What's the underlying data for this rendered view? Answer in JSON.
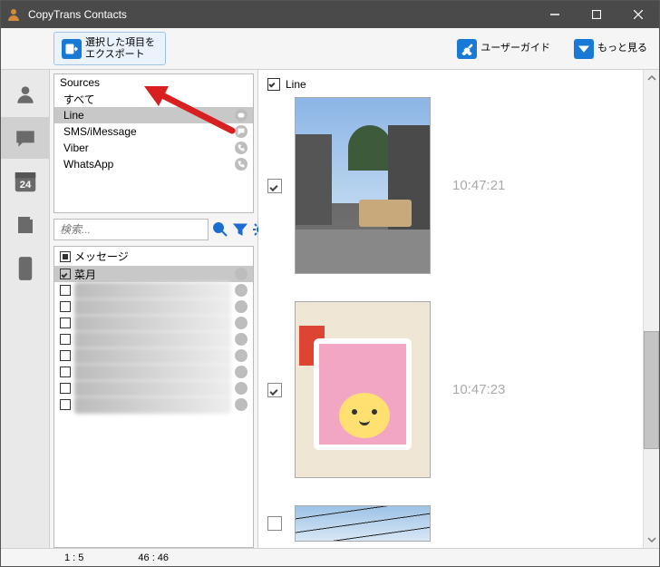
{
  "app": {
    "title": "CopyTrans Contacts"
  },
  "window_controls": {
    "min": "min",
    "max": "max",
    "close": "close"
  },
  "toolbar": {
    "export_label_line1": "選択した項目を",
    "export_label_line2": "エクスポート",
    "user_guide": "ユーザーガイド",
    "more": "もっと見る"
  },
  "nav": [
    {
      "id": "contacts",
      "name": "nav-contacts"
    },
    {
      "id": "messages",
      "name": "nav-messages",
      "active": true
    },
    {
      "id": "calendar",
      "name": "nav-calendar",
      "badge": "24"
    },
    {
      "id": "notes",
      "name": "nav-notes"
    },
    {
      "id": "device",
      "name": "nav-device"
    }
  ],
  "sources": {
    "heading": "Sources",
    "items": [
      {
        "label": "すべて",
        "icon": false,
        "selected": false
      },
      {
        "label": "Line",
        "icon": true,
        "selected": true
      },
      {
        "label": "SMS/iMessage",
        "icon": true,
        "selected": false
      },
      {
        "label": "Viber",
        "icon": true,
        "selected": false
      },
      {
        "label": "WhatsApp",
        "icon": true,
        "selected": false
      }
    ]
  },
  "search": {
    "placeholder": "検索..."
  },
  "messages_panel": {
    "heading": "メッセージ",
    "items": [
      {
        "label": "菜月",
        "checked": true,
        "selected": true,
        "blurred": false
      },
      {
        "label": "",
        "checked": false,
        "selected": false,
        "blurred": true
      },
      {
        "label": "",
        "checked": false,
        "selected": false,
        "blurred": true
      },
      {
        "label": "",
        "checked": false,
        "selected": false,
        "blurred": true
      },
      {
        "label": "",
        "checked": false,
        "selected": false,
        "blurred": true
      },
      {
        "label": "",
        "checked": false,
        "selected": false,
        "blurred": true
      },
      {
        "label": "",
        "checked": false,
        "selected": false,
        "blurred": true
      },
      {
        "label": "",
        "checked": false,
        "selected": false,
        "blurred": true
      },
      {
        "label": "",
        "checked": false,
        "selected": false,
        "blurred": true
      }
    ]
  },
  "thread": {
    "title_checked": true,
    "title": "Line",
    "photos": [
      {
        "checked": true,
        "time": "10:47:21",
        "kind": "street"
      },
      {
        "checked": true,
        "time": "10:47:23",
        "kind": "store"
      },
      {
        "checked": false,
        "time": "",
        "kind": "wires"
      }
    ]
  },
  "status": {
    "left": "1 : 5",
    "right": "46 : 46"
  }
}
